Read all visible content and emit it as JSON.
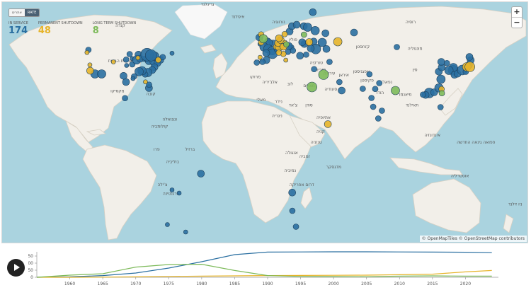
{
  "toggle": {
    "left": "אתרים",
    "right": "RATE"
  },
  "stats": [
    {
      "label": "IN SERVICE",
      "value": "174",
      "color": "#2a6fa1"
    },
    {
      "label": "PERMANENT SHUTDOWN",
      "value": "48",
      "color": "#e6b42a"
    },
    {
      "label": "LONG TERM SHUTDOWN",
      "value": "8",
      "color": "#7dba5a"
    }
  ],
  "zoom": {
    "in": "+",
    "out": "−"
  },
  "attribution": "© OpenMapTiles © OpenStreetMap contributors",
  "colors": {
    "in_service": "#2a6fa1",
    "shutdown": "#e6b42a",
    "long_term": "#7dba5a"
  },
  "icons": {
    "play": "play-icon",
    "zoom_in": "plus-icon",
    "zoom_out": "minus-icon"
  },
  "map_labels": [
    {
      "text": "רוסיה",
      "lon": 100,
      "lat": 62
    },
    {
      "text": "קנדה",
      "lon": -100,
      "lat": 60
    },
    {
      "text": "ארצות הברית",
      "lon": -100,
      "lat": 40
    },
    {
      "text": "מקסיקו",
      "lon": -102,
      "lat": 23
    },
    {
      "text": "קובה",
      "lon": -79,
      "lat": 21.5
    },
    {
      "text": "ונצואלה",
      "lon": -66,
      "lat": 7
    },
    {
      "text": "קולומביה",
      "lon": -73,
      "lat": 3
    },
    {
      "text": "פרו",
      "lon": -75,
      "lat": -10
    },
    {
      "text": "ברזיל",
      "lon": -52,
      "lat": -10
    },
    {
      "text": "בוליביה",
      "lon": -64,
      "lat": -17
    },
    {
      "text": "ארגנטינה",
      "lon": -65,
      "lat": -35
    },
    {
      "text": "צ'ילה",
      "lon": -71,
      "lat": -30
    },
    {
      "text": "גרינלנד",
      "lon": -40,
      "lat": 72
    },
    {
      "text": "איסלנד",
      "lon": -19,
      "lat": 65
    },
    {
      "text": "נורווגיה",
      "lon": 9,
      "lat": 62
    },
    {
      "text": "פולין",
      "lon": 19,
      "lat": 52
    },
    {
      "text": "אוקראינה",
      "lon": 31,
      "lat": 49
    },
    {
      "text": "ספרד",
      "lon": -4,
      "lat": 40
    },
    {
      "text": "מרוקו",
      "lon": -7,
      "lat": 31
    },
    {
      "text": "אלג'יריה",
      "lon": 3,
      "lat": 28
    },
    {
      "text": "לוב",
      "lon": 17,
      "lat": 27
    },
    {
      "text": "מצרים",
      "lon": 30,
      "lat": 26
    },
    {
      "text": "ניז'ר",
      "lon": 9,
      "lat": 17
    },
    {
      "text": "מאלי",
      "lon": -3,
      "lat": 18
    },
    {
      "text": "צ'אד",
      "lon": 19,
      "lat": 15
    },
    {
      "text": "סודן",
      "lon": 30,
      "lat": 15
    },
    {
      "text": "אתיופיה",
      "lon": 40,
      "lat": 8
    },
    {
      "text": "ניגריה",
      "lon": 8,
      "lat": 9
    },
    {
      "text": "קניה",
      "lon": 38,
      "lat": 0
    },
    {
      "text": "טנזניה",
      "lon": 35,
      "lat": -6
    },
    {
      "text": "אנגולה",
      "lon": 18,
      "lat": -12
    },
    {
      "text": "זמביה",
      "lon": 27,
      "lat": -14
    },
    {
      "text": "נמיביה",
      "lon": 17,
      "lat": -22
    },
    {
      "text": "דרום אפריקה",
      "lon": 25,
      "lat": -30
    },
    {
      "text": "מדגסקר",
      "lon": 47,
      "lat": -20
    },
    {
      "text": "טורקיה",
      "lon": 35,
      "lat": 39
    },
    {
      "text": "סוריה",
      "lon": 38,
      "lat": 35
    },
    {
      "text": "עיראק",
      "lon": 44,
      "lat": 33
    },
    {
      "text": "איראן",
      "lon": 54,
      "lat": 32
    },
    {
      "text": "סעודיה",
      "lon": 45,
      "lat": 24
    },
    {
      "text": "קזחסטן",
      "lon": 67,
      "lat": 48
    },
    {
      "text": "אפגניסטן",
      "lon": 66,
      "lat": 34
    },
    {
      "text": "פקיסטן",
      "lon": 70,
      "lat": 29
    },
    {
      "text": "הודו",
      "lon": 79,
      "lat": 22
    },
    {
      "text": "סין",
      "lon": 103,
      "lat": 35
    },
    {
      "text": "מונגוליה",
      "lon": 103,
      "lat": 47
    },
    {
      "text": "מיאנמר",
      "lon": 96,
      "lat": 21
    },
    {
      "text": "תאילנד",
      "lon": 101,
      "lat": 15
    },
    {
      "text": "אינדונזיה",
      "lon": 115,
      "lat": -2
    },
    {
      "text": "אוסטרליה",
      "lon": 134,
      "lat": -25
    },
    {
      "text": "פפואה גינאה החדשה",
      "lon": 145,
      "lat": -6
    },
    {
      "text": "ניו זילנד",
      "lon": 172,
      "lat": -41
    },
    {
      "text": "יפן",
      "lon": 138,
      "lat": 37
    },
    {
      "text": "נפאל",
      "lon": 84,
      "lat": 28
    }
  ],
  "reactors": [
    {
      "lon": -122,
      "lat": 47,
      "r": 4,
      "s": "in_service"
    },
    {
      "lon": -123,
      "lat": 45.5,
      "r": 3,
      "s": "shutdown"
    },
    {
      "lon": -121,
      "lat": 38.5,
      "r": 3,
      "s": "shutdown"
    },
    {
      "lon": -120.8,
      "lat": 35.2,
      "r": 5,
      "s": "shutdown"
    },
    {
      "lon": -117.5,
      "lat": 33.4,
      "r": 6,
      "s": "in_service"
    },
    {
      "lon": -112.9,
      "lat": 33.4,
      "r": 6,
      "s": "in_service"
    },
    {
      "lon": -104.8,
      "lat": 40.2,
      "r": 3,
      "s": "shutdown"
    },
    {
      "lon": -96,
      "lat": 41.5,
      "r": 4,
      "s": "in_service"
    },
    {
      "lon": -95.7,
      "lat": 38.2,
      "r": 3,
      "s": "in_service"
    },
    {
      "lon": -93.6,
      "lat": 44.6,
      "r": 4,
      "s": "in_service"
    },
    {
      "lon": -91.8,
      "lat": 42.1,
      "r": 3,
      "s": "in_service"
    },
    {
      "lon": -91.8,
      "lat": 38.8,
      "r": 4,
      "s": "in_service"
    },
    {
      "lon": -87.5,
      "lat": 44.3,
      "r": 5,
      "s": "in_service"
    },
    {
      "lon": -88.8,
      "lat": 41.3,
      "r": 6,
      "s": "in_service"
    },
    {
      "lon": -87.9,
      "lat": 42.5,
      "r": 3,
      "s": "shutdown"
    },
    {
      "lon": -86.3,
      "lat": 42,
      "r": 5,
      "s": "in_service"
    },
    {
      "lon": -83.3,
      "lat": 41.9,
      "r": 4,
      "s": "in_service"
    },
    {
      "lon": -81.1,
      "lat": 41.8,
      "r": 4,
      "s": "in_service"
    },
    {
      "lon": -80.4,
      "lat": 40.6,
      "r": 5,
      "s": "in_service"
    },
    {
      "lon": -76.7,
      "lat": 40.2,
      "r": 6,
      "s": "in_service"
    },
    {
      "lon": -76.4,
      "lat": 43.5,
      "r": 6,
      "s": "in_service"
    },
    {
      "lon": -81.6,
      "lat": 44.3,
      "r": 9,
      "s": "in_service"
    },
    {
      "lon": -78.9,
      "lat": 43.9,
      "r": 8,
      "s": "in_service"
    },
    {
      "lon": -72.5,
      "lat": 41.3,
      "r": 5,
      "s": "in_service"
    },
    {
      "lon": -70.8,
      "lat": 42.9,
      "r": 4,
      "s": "in_service"
    },
    {
      "lon": -73.9,
      "lat": 41.3,
      "r": 4,
      "s": "shutdown"
    },
    {
      "lon": -74.5,
      "lat": 39.5,
      "r": 5,
      "s": "in_service"
    },
    {
      "lon": -76.5,
      "lat": 37.2,
      "r": 5,
      "s": "in_service"
    },
    {
      "lon": -78,
      "lat": 35.6,
      "r": 5,
      "s": "in_service"
    },
    {
      "lon": -81.1,
      "lat": 34.2,
      "r": 6,
      "s": "in_service"
    },
    {
      "lon": -82.9,
      "lat": 33.1,
      "r": 4,
      "s": "in_service"
    },
    {
      "lon": -85.1,
      "lat": 35.2,
      "r": 6,
      "s": "in_service"
    },
    {
      "lon": -87.1,
      "lat": 34.7,
      "r": 6,
      "s": "in_service"
    },
    {
      "lon": -90.5,
      "lat": 32,
      "r": 4,
      "s": "in_service"
    },
    {
      "lon": -91.3,
      "lat": 30.8,
      "r": 3,
      "s": "in_service"
    },
    {
      "lon": -96.1,
      "lat": 28.8,
      "r": 5,
      "s": "in_service"
    },
    {
      "lon": -97.8,
      "lat": 32.3,
      "r": 5,
      "s": "in_service"
    },
    {
      "lon": -80.3,
      "lat": 25.4,
      "r": 5,
      "s": "in_service"
    },
    {
      "lon": -80.2,
      "lat": 27.3,
      "r": 4,
      "s": "in_service"
    },
    {
      "lon": -82.7,
      "lat": 28.9,
      "r": 3,
      "s": "shutdown"
    },
    {
      "lon": -64.4,
      "lat": 45.1,
      "r": 3,
      "s": "in_service"
    },
    {
      "lon": -96.8,
      "lat": 19.7,
      "r": 4,
      "s": "in_service"
    },
    {
      "lon": -44.5,
      "lat": -23,
      "r": 5,
      "s": "in_service"
    },
    {
      "lon": -59.5,
      "lat": -34,
      "r": 3,
      "s": "in_service"
    },
    {
      "lon": -64.4,
      "lat": -32.2,
      "r": 3,
      "s": "in_service"
    },
    {
      "lon": -4.2,
      "lat": 54,
      "r": 5,
      "s": "in_service"
    },
    {
      "lon": -3,
      "lat": 55.7,
      "r": 4,
      "s": "shutdown"
    },
    {
      "lon": -3,
      "lat": 51.2,
      "r": 4,
      "s": "shutdown"
    },
    {
      "lon": 1.6,
      "lat": 52.2,
      "r": 4,
      "s": "in_service"
    },
    {
      "lon": -1.5,
      "lat": 53.3,
      "r": 6,
      "s": "long_term"
    },
    {
      "lon": -3.8,
      "lat": 50.3,
      "r": 3,
      "s": "in_service"
    },
    {
      "lon": 3.7,
      "lat": 51.3,
      "r": 3,
      "s": "in_service"
    },
    {
      "lon": 5.3,
      "lat": 50.6,
      "r": 5,
      "s": "in_service"
    },
    {
      "lon": 1.9,
      "lat": 50.9,
      "r": 6,
      "s": "in_service"
    },
    {
      "lon": -1,
      "lat": 48.6,
      "r": 6,
      "s": "in_service"
    },
    {
      "lon": 1.6,
      "lat": 47.7,
      "r": 6,
      "s": "in_service"
    },
    {
      "lon": 4.6,
      "lat": 46.5,
      "r": 6,
      "s": "in_service"
    },
    {
      "lon": 4.8,
      "lat": 44.8,
      "r": 7,
      "s": "in_service"
    },
    {
      "lon": 0.5,
      "lat": 45.2,
      "r": 5,
      "s": "in_service"
    },
    {
      "lon": 7.3,
      "lat": 48.8,
      "r": 4,
      "s": "shutdown"
    },
    {
      "lon": 8.3,
      "lat": 47.5,
      "r": 5,
      "s": "in_service"
    },
    {
      "lon": 9.5,
      "lat": 48.8,
      "r": 6,
      "s": "shutdown"
    },
    {
      "lon": 8.7,
      "lat": 50.9,
      "r": 5,
      "s": "shutdown"
    },
    {
      "lon": 10.5,
      "lat": 52.5,
      "r": 5,
      "s": "shutdown"
    },
    {
      "lon": 9.3,
      "lat": 53.6,
      "r": 5,
      "s": "shutdown"
    },
    {
      "lon": 12.4,
      "lat": 48.8,
      "r": 5,
      "s": "shutdown"
    },
    {
      "lon": 13.5,
      "lat": 51.2,
      "r": 3,
      "s": "shutdown"
    },
    {
      "lon": 14.4,
      "lat": 50.1,
      "r": 4,
      "s": "long_term"
    },
    {
      "lon": 12.3,
      "lat": 44.7,
      "r": 4,
      "s": "shutdown"
    },
    {
      "lon": 9.2,
      "lat": 45.4,
      "r": 4,
      "s": "shutdown"
    },
    {
      "lon": 14,
      "lat": 41.2,
      "r": 3,
      "s": "shutdown"
    },
    {
      "lon": 0.6,
      "lat": 41.2,
      "r": 5,
      "s": "in_service"
    },
    {
      "lon": -2.1,
      "lat": 40.2,
      "r": 4,
      "s": "in_service"
    },
    {
      "lon": -6,
      "lat": 39.8,
      "r": 4,
      "s": "in_service"
    },
    {
      "lon": -3.7,
      "lat": 42.8,
      "r": 3,
      "s": "shutdown"
    },
    {
      "lon": 13.2,
      "lat": 55.9,
      "r": 4,
      "s": "shutdown"
    },
    {
      "lon": 16.6,
      "lat": 57.4,
      "r": 5,
      "s": "in_service"
    },
    {
      "lon": 18.2,
      "lat": 60.4,
      "r": 5,
      "s": "in_service"
    },
    {
      "lon": 21.5,
      "lat": 61.2,
      "r": 5,
      "s": "in_service"
    },
    {
      "lon": 26.4,
      "lat": 60.4,
      "r": 5,
      "s": "in_service"
    },
    {
      "lon": 29,
      "lat": 59.8,
      "r": 6,
      "s": "in_service"
    },
    {
      "lon": 26.5,
      "lat": 55.6,
      "r": 4,
      "s": "long_term"
    },
    {
      "lon": 34.2,
      "lat": 57.9,
      "r": 6,
      "s": "in_service"
    },
    {
      "lon": 32.6,
      "lat": 68.3,
      "r": 5,
      "s": "in_service"
    },
    {
      "lon": 33.2,
      "lat": 51.7,
      "r": 5,
      "s": "in_service"
    },
    {
      "lon": 39.1,
      "lat": 51.2,
      "r": 6,
      "s": "in_service"
    },
    {
      "lon": 42,
      "lat": 47.5,
      "r": 5,
      "s": "in_service"
    },
    {
      "lon": 49.8,
      "lat": 51.6,
      "r": 6,
      "s": "shutdown"
    },
    {
      "lon": 61,
      "lat": 56.8,
      "r": 5,
      "s": "in_service"
    },
    {
      "lon": 41.3,
      "lat": 56.4,
      "r": 5,
      "s": "in_service"
    },
    {
      "lon": 26.8,
      "lat": 50.3,
      "r": 5,
      "s": "in_service"
    },
    {
      "lon": 34.6,
      "lat": 47.5,
      "r": 7,
      "s": "in_service"
    },
    {
      "lon": 31.2,
      "lat": 47.8,
      "r": 5,
      "s": "in_service"
    },
    {
      "lon": 30.1,
      "lat": 51.4,
      "r": 5,
      "s": "shutdown"
    },
    {
      "lon": 25.3,
      "lat": 51.3,
      "r": 5,
      "s": "in_service"
    },
    {
      "lon": 17.7,
      "lat": 48.4,
      "r": 4,
      "s": "in_service"
    },
    {
      "lon": 18.9,
      "lat": 46.6,
      "r": 4,
      "s": "in_service"
    },
    {
      "lon": 16.1,
      "lat": 49.2,
      "r": 5,
      "s": "in_service"
    },
    {
      "lon": 15.5,
      "lat": 45.9,
      "r": 4,
      "s": "in_service"
    },
    {
      "lon": 23.8,
      "lat": 43.7,
      "r": 5,
      "s": "in_service"
    },
    {
      "lon": 28,
      "lat": 44.3,
      "r": 4,
      "s": "in_service"
    },
    {
      "lon": 44.1,
      "lat": 40.2,
      "r": 4,
      "s": "in_service"
    },
    {
      "lon": 33.5,
      "lat": 36.1,
      "r": 4,
      "s": "in_service"
    },
    {
      "lon": 40,
      "lat": 33,
      "r": 7,
      "s": "long_term"
    },
    {
      "lon": 32,
      "lat": 26,
      "r": 7,
      "s": "long_term"
    },
    {
      "lon": 50.9,
      "lat": 28.8,
      "r": 4,
      "s": "in_service"
    },
    {
      "lon": 52.5,
      "lat": 24,
      "r": 5,
      "s": "in_service"
    },
    {
      "lon": 18.4,
      "lat": -33.7,
      "r": 5,
      "s": "in_service"
    },
    {
      "lon": 43,
      "lat": 5,
      "r": 5,
      "s": "shutdown"
    },
    {
      "lon": 67,
      "lat": 25,
      "r": 4,
      "s": "in_service"
    },
    {
      "lon": 71.6,
      "lat": 33.2,
      "r": 4,
      "s": "in_service"
    },
    {
      "lon": 73,
      "lat": 19.8,
      "r": 4,
      "s": "in_service"
    },
    {
      "lon": 75.6,
      "lat": 24.9,
      "r": 4,
      "s": "in_service"
    },
    {
      "lon": 78.4,
      "lat": 28.2,
      "r": 4,
      "s": "in_service"
    },
    {
      "lon": 74.2,
      "lat": 14.8,
      "r": 4,
      "s": "in_service"
    },
    {
      "lon": 80.2,
      "lat": 12.6,
      "r": 4,
      "s": "in_service"
    },
    {
      "lon": 77.7,
      "lat": 8.2,
      "r": 4,
      "s": "in_service"
    },
    {
      "lon": 89.5,
      "lat": 24,
      "r": 6,
      "s": "long_term"
    },
    {
      "lon": 112.8,
      "lat": 22.6,
      "r": 7,
      "s": "in_service"
    },
    {
      "lon": 110.3,
      "lat": 21.5,
      "r": 5,
      "s": "in_service"
    },
    {
      "lon": 108.5,
      "lat": 21.7,
      "r": 4,
      "s": "in_service"
    },
    {
      "lon": 116.2,
      "lat": 23,
      "r": 5,
      "s": "in_service"
    },
    {
      "lon": 119.5,
      "lat": 25.5,
      "r": 6,
      "s": "in_service"
    },
    {
      "lon": 120.9,
      "lat": 30.4,
      "r": 6,
      "s": "in_service"
    },
    {
      "lon": 121.3,
      "lat": 24.8,
      "r": 4,
      "s": "shutdown"
    },
    {
      "lon": 121.5,
      "lat": 22.5,
      "r": 4,
      "s": "long_term"
    },
    {
      "lon": 119.4,
      "lat": 34.7,
      "r": 5,
      "s": "in_service"
    },
    {
      "lon": 121.4,
      "lat": 37.1,
      "r": 5,
      "s": "in_service"
    },
    {
      "lon": 121.1,
      "lat": 40.2,
      "r": 5,
      "s": "in_service"
    },
    {
      "lon": 125,
      "lat": 39.5,
      "r": 4,
      "s": "in_service"
    },
    {
      "lon": 129.3,
      "lat": 35.5,
      "r": 7,
      "s": "in_service"
    },
    {
      "lon": 129.4,
      "lat": 37,
      "r": 6,
      "s": "in_service"
    },
    {
      "lon": 126.4,
      "lat": 35.4,
      "r": 6,
      "s": "in_service"
    },
    {
      "lon": 130.2,
      "lat": 32.9,
      "r": 5,
      "s": "in_service"
    },
    {
      "lon": 132.3,
      "lat": 33.5,
      "r": 5,
      "s": "in_service"
    },
    {
      "lon": 135.6,
      "lat": 35.6,
      "r": 7,
      "s": "in_service"
    },
    {
      "lon": 138.6,
      "lat": 37.4,
      "r": 6,
      "s": "shutdown"
    },
    {
      "lon": 140.8,
      "lat": 37.4,
      "r": 7,
      "s": "shutdown"
    },
    {
      "lon": 140.2,
      "lat": 38.4,
      "r": 5,
      "s": "in_service"
    },
    {
      "lon": 141.4,
      "lat": 41.2,
      "r": 5,
      "s": "in_service"
    },
    {
      "lon": 140.5,
      "lat": 43,
      "r": 5,
      "s": "in_service"
    },
    {
      "lon": 138,
      "lat": 34.6,
      "r": 4,
      "s": "in_service"
    },
    {
      "lon": 120.6,
      "lat": 14.6,
      "r": 4,
      "s": "in_service"
    },
    {
      "lon": 172.7,
      "lat": 64.4,
      "r": 4,
      "s": "in_service"
    },
    {
      "lon": 90.5,
      "lat": 48.6,
      "r": 4,
      "s": "in_service"
    },
    {
      "lon": -67.6,
      "lat": -51.8,
      "r": 3,
      "s": "in_service"
    },
    {
      "lon": -55,
      "lat": -56,
      "r": 3,
      "s": "in_service"
    },
    {
      "lon": 21,
      "lat": -53,
      "r": 4,
      "s": "in_service"
    },
    {
      "lon": 18.5,
      "lat": -44,
      "r": 4,
      "s": "in_service"
    }
  ],
  "chart_data": {
    "type": "line",
    "x": [
      1955,
      1960,
      1965,
      1970,
      1975,
      1980,
      1985,
      1990,
      1995,
      2000,
      2005,
      2010,
      2015,
      2020,
      2024
    ],
    "x_ticks": [
      1960,
      1965,
      1970,
      1975,
      1980,
      1985,
      1990,
      1995,
      2000,
      2005,
      2010,
      2015,
      2020
    ],
    "y_ticks": [
      0,
      50,
      100,
      150
    ],
    "ylim": [
      0,
      180
    ],
    "xlim": [
      1955,
      2025
    ],
    "grid": false,
    "series": [
      {
        "key": "in_service",
        "color": "#2a6fa1",
        "values": [
          0,
          3,
          12,
          30,
          65,
          110,
          160,
          178,
          179,
          180,
          180,
          179,
          178,
          177,
          174
        ]
      },
      {
        "key": "shutdown",
        "color": "#e6b42a",
        "values": [
          0,
          0,
          1,
          3,
          6,
          8,
          10,
          12,
          13,
          14,
          15,
          18,
          22,
          38,
          48
        ]
      },
      {
        "key": "long_term",
        "color": "#7dba5a",
        "values": [
          0,
          15,
          25,
          72,
          90,
          92,
          48,
          12,
          6,
          5,
          4,
          8,
          10,
          8,
          8
        ]
      }
    ]
  }
}
